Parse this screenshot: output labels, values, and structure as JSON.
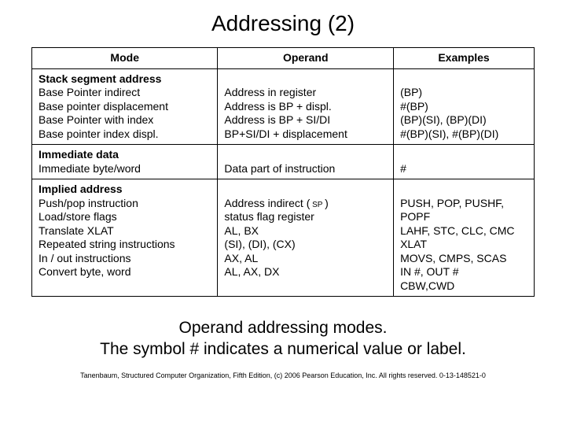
{
  "title": "Addressing (2)",
  "headers": {
    "mode": "Mode",
    "operand": "Operand",
    "examples": "Examples"
  },
  "sections": [
    {
      "header": "Stack segment address",
      "rows": [
        {
          "mode": "Base Pointer indirect",
          "operand": "Address in register",
          "examples": "(BP)"
        },
        {
          "mode": "Base pointer displacement",
          "operand": "Address is BP + displ.",
          "examples": "#(BP)"
        },
        {
          "mode": "Base Pointer with index",
          "operand": "Address is BP + SI/DI",
          "examples": "(BP)(SI), (BP)(DI)"
        },
        {
          "mode": "Base pointer index displ.",
          "operand": "BP+SI/DI + displacement",
          "examples": "#(BP)(SI), #(BP)(DI)"
        }
      ]
    },
    {
      "header": "Immediate data",
      "rows": [
        {
          "mode": "Immediate byte/word",
          "operand": "Data part of instruction",
          "examples": "#"
        }
      ]
    },
    {
      "header": "Implied address",
      "rows": [
        {
          "mode": "Push/pop instruction",
          "operand": "Address indirect ( SP )",
          "examples": "PUSH, POP, PUSHF, POPF"
        },
        {
          "mode": "Load/store flags",
          "operand": "status flag register",
          "examples": "LAHF, STC, CLC, CMC"
        },
        {
          "mode": "Translate XLAT",
          "operand": "AL, BX",
          "examples": "XLAT"
        },
        {
          "mode": "Repeated string instructions",
          "operand": "(SI), (DI), (CX)",
          "examples": "MOVS, CMPS, SCAS"
        },
        {
          "mode": "In / out instructions",
          "operand": "AX, AL",
          "examples": "IN #, OUT #"
        },
        {
          "mode": "Convert byte, word",
          "operand": "AL, AX, DX",
          "examples": "CBW,CWD"
        }
      ]
    }
  ],
  "caption_line1": "Operand addressing modes.",
  "caption_line2": "The symbol # indicates a numerical value or label.",
  "copyright": "Tanenbaum, Structured Computer Organization, Fifth Edition, (c) 2006 Pearson Education, Inc. All rights reserved. 0-13-148521-0"
}
